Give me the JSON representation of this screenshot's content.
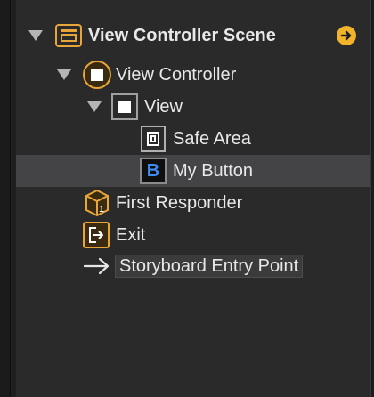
{
  "outline": {
    "scene": {
      "label": "View Controller Scene",
      "icon": "scene-icon",
      "accent": "#e8a53a",
      "goto_icon": "arrow-circle-right-icon"
    },
    "view_controller": {
      "label": "View Controller",
      "icon": "view-controller-icon"
    },
    "view": {
      "label": "View",
      "icon": "view-icon"
    },
    "safe_area": {
      "label": "Safe Area",
      "icon": "safe-area-icon"
    },
    "my_button": {
      "label": "My Button",
      "icon": "button-icon",
      "glyph": "B",
      "glyph_color": "#3e8ef7",
      "selected": true
    },
    "first_responder": {
      "label": "First Responder",
      "icon": "first-responder-icon"
    },
    "exit": {
      "label": "Exit",
      "icon": "exit-icon"
    },
    "entry_point": {
      "label": "Storyboard Entry Point",
      "icon": "arrow-right-icon"
    }
  }
}
